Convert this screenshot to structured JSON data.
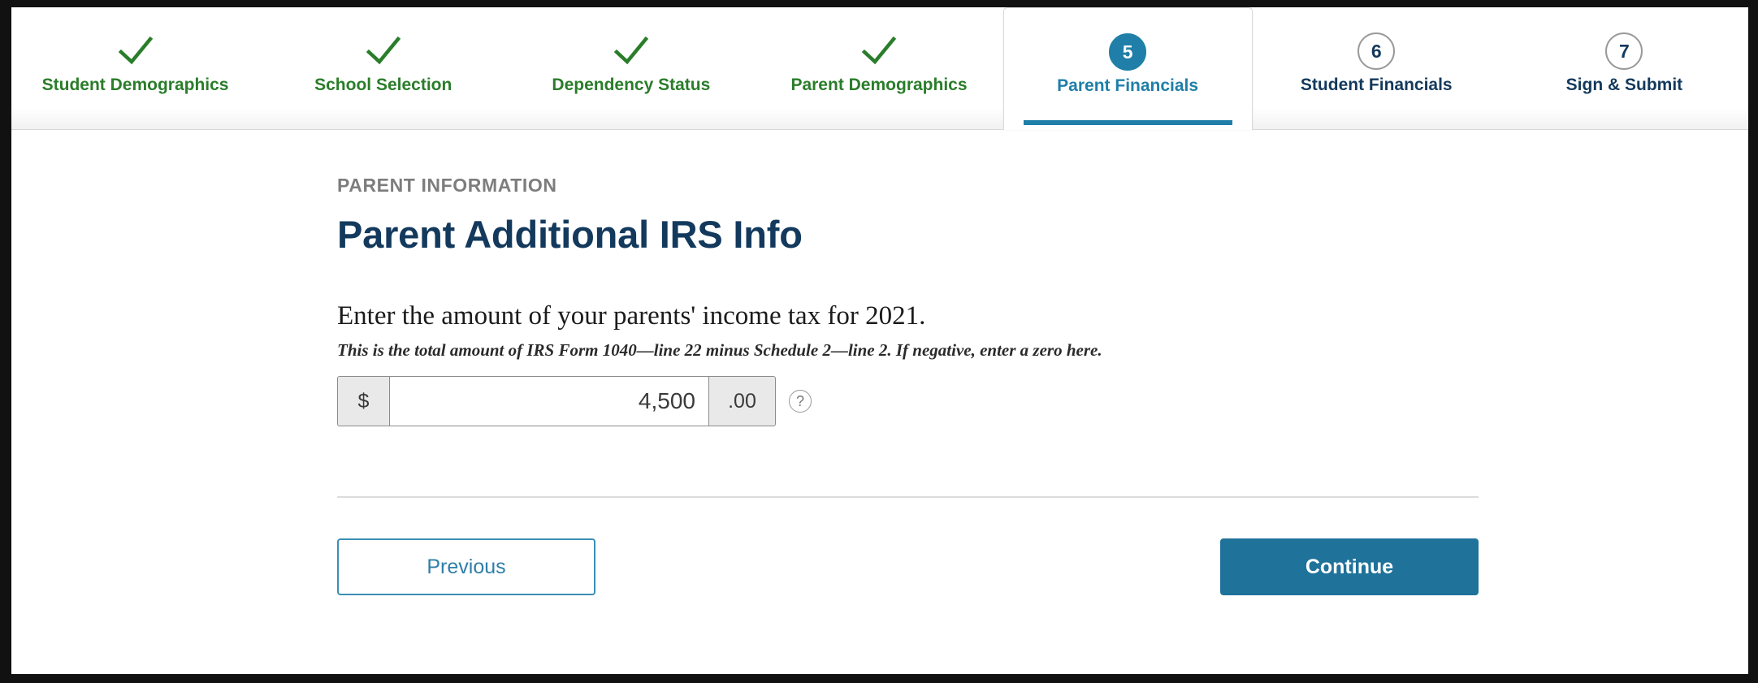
{
  "stepnav": {
    "steps": [
      {
        "label": "Student Demographics",
        "number": "1",
        "state": "done",
        "marker": "check-icon"
      },
      {
        "label": "School Selection",
        "number": "2",
        "state": "done",
        "marker": "check-icon"
      },
      {
        "label": "Dependency Status",
        "number": "3",
        "state": "done",
        "marker": "check-icon"
      },
      {
        "label": "Parent Demographics",
        "number": "4",
        "state": "done",
        "marker": "check-icon"
      },
      {
        "label": "Parent Financials",
        "number": "5",
        "state": "current",
        "marker": "number-circle"
      },
      {
        "label": "Student Financials",
        "number": "6",
        "state": "todo",
        "marker": "number-circle"
      },
      {
        "label": "Sign & Submit",
        "number": "7",
        "state": "todo",
        "marker": "number-circle"
      }
    ]
  },
  "main": {
    "eyebrow": "PARENT INFORMATION",
    "title": "Parent Additional IRS Info",
    "question": "Enter the amount of your parents' income tax for 2021.",
    "hint": "This is the total amount of IRS Form 1040—line 22 minus Schedule 2—line 2. If negative, enter a zero here.",
    "amount_field": {
      "prefix": "$",
      "value": "4,500",
      "placeholder": "",
      "suffix": ".00",
      "help_icon": "question-mark-circle-icon"
    }
  },
  "actions": {
    "previous_label": "Previous",
    "continue_label": "Continue"
  },
  "colors": {
    "accent_blue": "#1f7299",
    "tab_blue": "#1f7fa8",
    "done_green": "#2a7d2a",
    "heading_navy": "#13395c",
    "eyebrow_gray": "#7d7d7d"
  }
}
